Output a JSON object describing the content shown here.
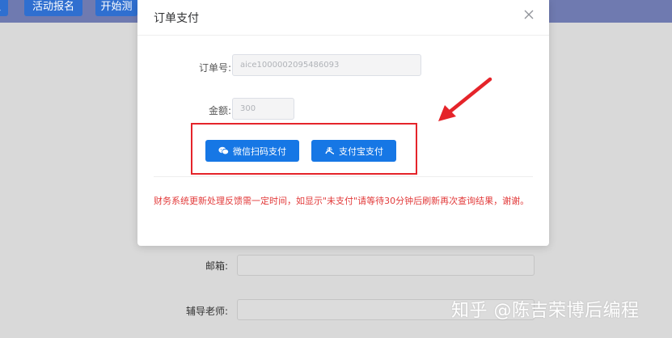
{
  "background": {
    "topbar_buttons": [
      {
        "label": "员"
      },
      {
        "label": "活动报名"
      },
      {
        "label": "开始测"
      }
    ],
    "form": {
      "email_label": "邮箱:",
      "teacher_label": "辅导老师:"
    },
    "watermark": "知乎 @陈吉荣博后编程"
  },
  "modal": {
    "title": "订单支付",
    "close_icon": "close-icon",
    "order_label": "订单号:",
    "order_value": "aice1000002095486093",
    "amount_label": "金额:",
    "amount_value": "300",
    "buttons": {
      "wechat": {
        "label": "微信扫码支付",
        "icon": "wechat-icon"
      },
      "alipay": {
        "label": "支付宝支付",
        "icon": "alipay-icon"
      }
    },
    "notice": "财务系统更新处理反馈需一定时间，如显示\"未支付\"请等待30分钟后刷新再次查询结果，谢谢。"
  },
  "colors": {
    "primary": "#1677e5",
    "highlight": "#e5242a",
    "notice_text": "#e23a3a",
    "topbar": "#6f7ab0"
  }
}
